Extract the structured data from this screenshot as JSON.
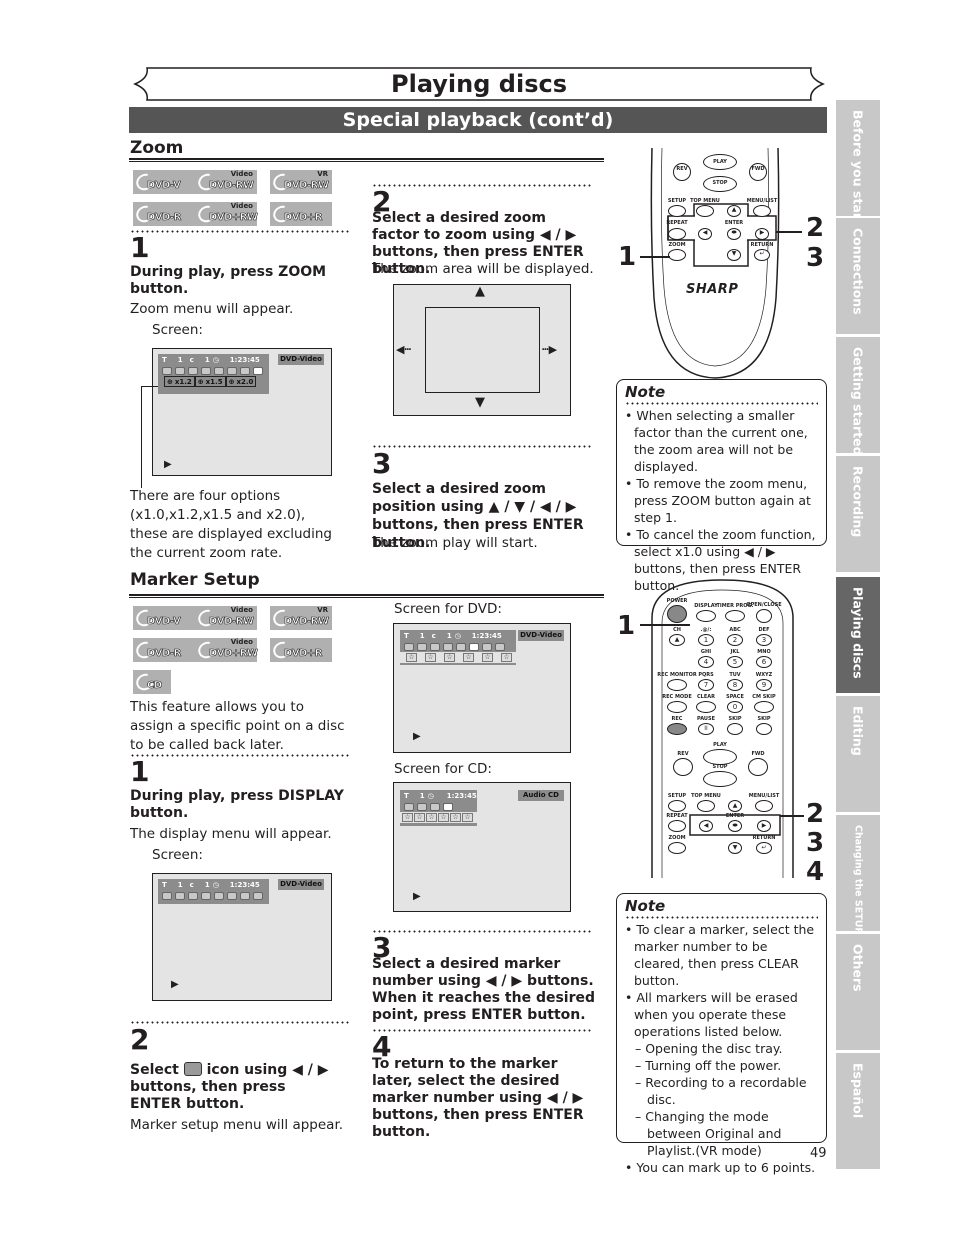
{
  "header": {
    "title": "Playing discs",
    "section": "Special playback (cont’d)"
  },
  "zoom": {
    "heading": "Zoom",
    "discs": [
      {
        "sup": "",
        "label": "DVD-V"
      },
      {
        "sup": "Video",
        "label": "DVD-RW"
      },
      {
        "sup": "VR",
        "label": "DVD-RW"
      },
      {
        "sup": "",
        "label": "DVD-R"
      },
      {
        "sup": "Video",
        "label": "DVD+RW"
      },
      {
        "sup": "",
        "label": "DVD+R"
      }
    ],
    "step1": {
      "num": "1",
      "instruction": "During play, press ZOOM button.",
      "result": "Zoom menu will appear.",
      "screen_label": "Screen:",
      "osd": {
        "title_label": "T",
        "title_num": "1",
        "chapter_label": "c",
        "chapter_num": "1",
        "time": "1:23:45",
        "disc_type": "DVD-Video",
        "zoom_options": [
          "x1.2",
          "x1.5",
          "x2.0"
        ],
        "play_symbol": "▶"
      },
      "caption": "There are four options (x1.0,x1.2,x1.5 and x2.0), these are displayed excluding the current zoom rate."
    },
    "step2": {
      "num": "2",
      "instruction": "Select a desired zoom factor to zoom using ◀ / ▶ buttons, then press ENTER button.",
      "result": "The zoom area will be displayed."
    },
    "step3": {
      "num": "3",
      "instruction": "Select a desired zoom position using ▲ / ▼ / ◀ / ▶ buttons, then press ENTER button.",
      "result": "The zoom play will start."
    },
    "remote": {
      "buttons": {
        "rev": "REV",
        "play": "PLAY",
        "fwd": "FWD",
        "stop": "STOP",
        "setup": "SETUP",
        "top_menu": "TOP MENU",
        "menu_list": "MENU/LIST",
        "repeat": "REPEAT",
        "enter": "ENTER",
        "zoom": "ZOOM",
        "return": "RETURN"
      },
      "brand": "SHARP",
      "callouts": [
        "1",
        "2",
        "3"
      ]
    },
    "note": {
      "title": "Note",
      "items": [
        "When selecting a smaller factor than the current one, the zoom area will not be displayed.",
        "To remove the zoom menu, press ZOOM button again at step 1.",
        "To cancel the zoom function, select x1.0 using ◀ / ▶ buttons, then press ENTER button."
      ]
    }
  },
  "marker": {
    "heading": "Marker Setup",
    "discs": [
      {
        "sup": "",
        "label": "DVD-V"
      },
      {
        "sup": "Video",
        "label": "DVD-RW"
      },
      {
        "sup": "VR",
        "label": "DVD-RW"
      },
      {
        "sup": "",
        "label": "DVD-R"
      },
      {
        "sup": "Video",
        "label": "DVD+RW"
      },
      {
        "sup": "",
        "label": "DVD+R"
      },
      {
        "sup": "",
        "label": "CD"
      }
    ],
    "intro": "This feature allows you to assign a specific point on a disc to be called back later.",
    "step1": {
      "num": "1",
      "instruction": "During play, press DISPLAY button.",
      "result": "The display menu will appear.",
      "screen_label": "Screen:",
      "osd": {
        "title_label": "T",
        "title_num": "1",
        "chapter_label": "c",
        "chapter_num": "1",
        "time": "1:23:45",
        "disc_type": "DVD-Video",
        "play_symbol": "▶"
      }
    },
    "step2": {
      "num": "2",
      "instruction_pre": "Select",
      "instruction_post": "icon using ◀ / ▶ buttons, then press ENTER button.",
      "result": "Marker setup menu will appear."
    },
    "screen_dvd": {
      "label": "Screen for DVD:",
      "osd": {
        "title_label": "T",
        "title_num": "1",
        "chapter_label": "c",
        "chapter_num": "1",
        "time": "1:23:45",
        "disc_type": "DVD-Video",
        "markers": 6,
        "play_symbol": "▶"
      }
    },
    "screen_cd": {
      "label": "Screen for CD:",
      "osd": {
        "track_label": "T",
        "track_num": "1",
        "time": "1:23:45",
        "disc_type": "Audio CD",
        "markers": 6,
        "play_symbol": "▶"
      }
    },
    "step3": {
      "num": "3",
      "instruction": "Select a desired marker number using ◀ / ▶ buttons. When it reaches the desired point, press ENTER button."
    },
    "step4": {
      "num": "4",
      "instruction": "To return to the marker later, select the desired marker number using ◀ / ▶ buttons, then press ENTER button."
    },
    "remote": {
      "buttons": {
        "power": "POWER",
        "display": "DISPLAY",
        "timer_prog": "TIMER PROG.",
        "open_close": "OPEN/CLOSE",
        "k1": "1",
        "k1_sub": ".@/:",
        "k2": "2",
        "k2_sub": "ABC",
        "k3": "3",
        "k3_sub": "DEF",
        "ch": "CH",
        "k4": "4",
        "k4_sub": "GHI",
        "k5": "5",
        "k5_sub": "JKL",
        "k6": "6",
        "k6_sub": "MNO",
        "rec_monitor": "REC MONITOR",
        "k7": "7",
        "k7_sub": "PQRS",
        "k8": "8",
        "k8_sub": "TUV",
        "k9": "9",
        "k9_sub": "WXYZ",
        "rec_mode": "REC MODE",
        "clear": "CLEAR",
        "space": "SPACE",
        "k0": "0",
        "cm_skip": "CM SKIP",
        "rec": "REC",
        "pause": "PAUSE",
        "skip": "SKIP",
        "rev": "REV",
        "play": "PLAY",
        "fwd": "FWD",
        "stop": "STOP",
        "setup": "SETUP",
        "top_menu": "TOP MENU",
        "menu_list": "MENU/LIST",
        "repeat": "REPEAT",
        "enter": "ENTER",
        "zoom": "ZOOM",
        "return": "RETURN"
      },
      "callouts": [
        "1",
        "2",
        "3",
        "4"
      ]
    },
    "note": {
      "title": "Note",
      "items": [
        {
          "type": "bullet",
          "text": "To clear a marker, select the marker number to be cleared, then press CLEAR button."
        },
        {
          "type": "bullet",
          "text": "All markers will be erased when you operate these operations listed below."
        },
        {
          "type": "sub",
          "text": "– Opening the disc tray."
        },
        {
          "type": "sub",
          "text": "– Turning off the power."
        },
        {
          "type": "sub",
          "text": "– Recording to a recordable disc."
        },
        {
          "type": "sub",
          "text": "– Changing the mode between Original and Playlist.(VR mode)"
        },
        {
          "type": "bullet",
          "text": "You can mark up to 6 points."
        }
      ]
    }
  },
  "side_tabs": [
    {
      "label": "Before you start",
      "active": false
    },
    {
      "label": "Connections",
      "active": false
    },
    {
      "label": "Getting started",
      "active": false
    },
    {
      "label": "Recording",
      "active": false
    },
    {
      "label": "Playing discs",
      "active": true
    },
    {
      "label": "Editing",
      "active": false
    },
    {
      "label": "Changing the SETUP menu",
      "active": false
    },
    {
      "label": "Others",
      "active": false
    },
    {
      "label": "Español",
      "active": false
    }
  ],
  "page_number": "49"
}
